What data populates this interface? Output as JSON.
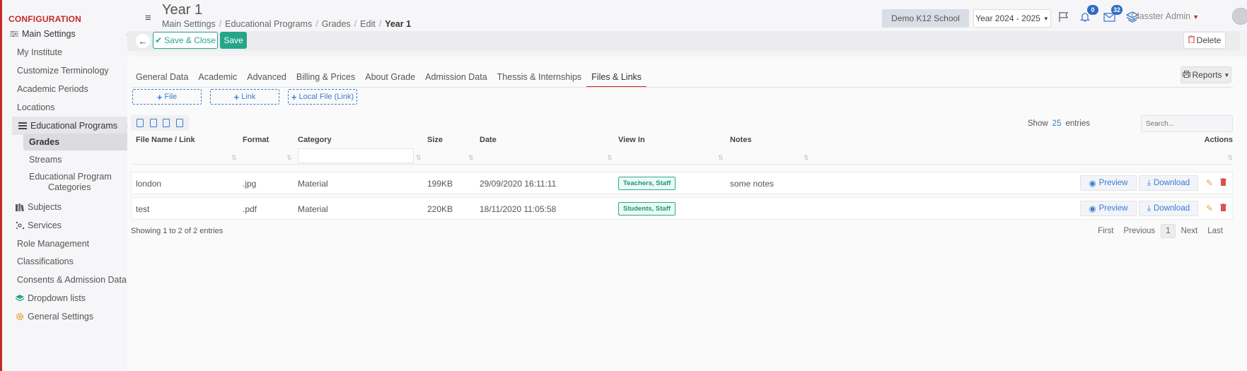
{
  "sidebar": {
    "title": "CONFIGURATION",
    "items": [
      {
        "label": "Main Settings"
      },
      {
        "label": "My Institute"
      },
      {
        "label": "Customize Terminology"
      },
      {
        "label": "Academic Periods"
      },
      {
        "label": "Locations"
      },
      {
        "label": "Educational Programs"
      },
      {
        "label": "Grades"
      },
      {
        "label": "Streams"
      },
      {
        "label": "Educational Program"
      },
      {
        "label": "Categories"
      },
      {
        "label": "Subjects"
      },
      {
        "label": "Services"
      },
      {
        "label": "Role Management"
      },
      {
        "label": "Classifications"
      },
      {
        "label": "Consents & Admission Data"
      },
      {
        "label": "Dropdown lists"
      },
      {
        "label": "General Settings"
      }
    ]
  },
  "header": {
    "title": "Year 1",
    "breadcrumb": [
      "Main Settings",
      "Educational Programs",
      "Grades",
      "Edit",
      "Year 1"
    ],
    "school": "Demo K12 School",
    "year": "Year 2024 - 2025",
    "notifications_count": "0",
    "messages_count": "32",
    "user": "Classter Admin"
  },
  "toolbar": {
    "save_close_label": "Save & Close",
    "save_label": "Save",
    "delete_label": "Delete"
  },
  "tabs": [
    {
      "label": "General Data"
    },
    {
      "label": "Academic"
    },
    {
      "label": "Advanced"
    },
    {
      "label": "Billing & Prices"
    },
    {
      "label": "About Grade"
    },
    {
      "label": "Admission Data"
    },
    {
      "label": "Thessis & Internships"
    },
    {
      "label": "Files & Links"
    }
  ],
  "reports_label": "Reports",
  "add_buttons": {
    "file": "File",
    "link": "Link",
    "local_file": "Local File (Link)"
  },
  "table": {
    "show_label": "Show",
    "entries_count": "25",
    "entries_label": "entries",
    "search_placeholder": "Search...",
    "columns": [
      "File Name / Link",
      "Format",
      "Category",
      "Size",
      "Date",
      "View In",
      "Notes",
      "Actions"
    ],
    "rows": [
      {
        "name": "london",
        "format": ".jpg",
        "category": "Material",
        "size": "199KB",
        "date": "29/09/2020 16:11:11",
        "view_in": "Teachers, Staff",
        "notes": "some notes"
      },
      {
        "name": "test",
        "format": ".pdf",
        "category": "Material",
        "size": "220KB",
        "date": "18/11/2020 11:05:58",
        "view_in": "Students, Staff",
        "notes": ""
      }
    ],
    "preview_label": "Preview",
    "download_label": "Download",
    "showing_text": "Showing 1 to 2 of 2 entries",
    "pager": {
      "first": "First",
      "previous": "Previous",
      "current": "1",
      "next": "Next",
      "last": "Last"
    }
  },
  "colors": {
    "accent_red": "#c62828",
    "green": "#26a688",
    "blue": "#3a7bd5"
  }
}
